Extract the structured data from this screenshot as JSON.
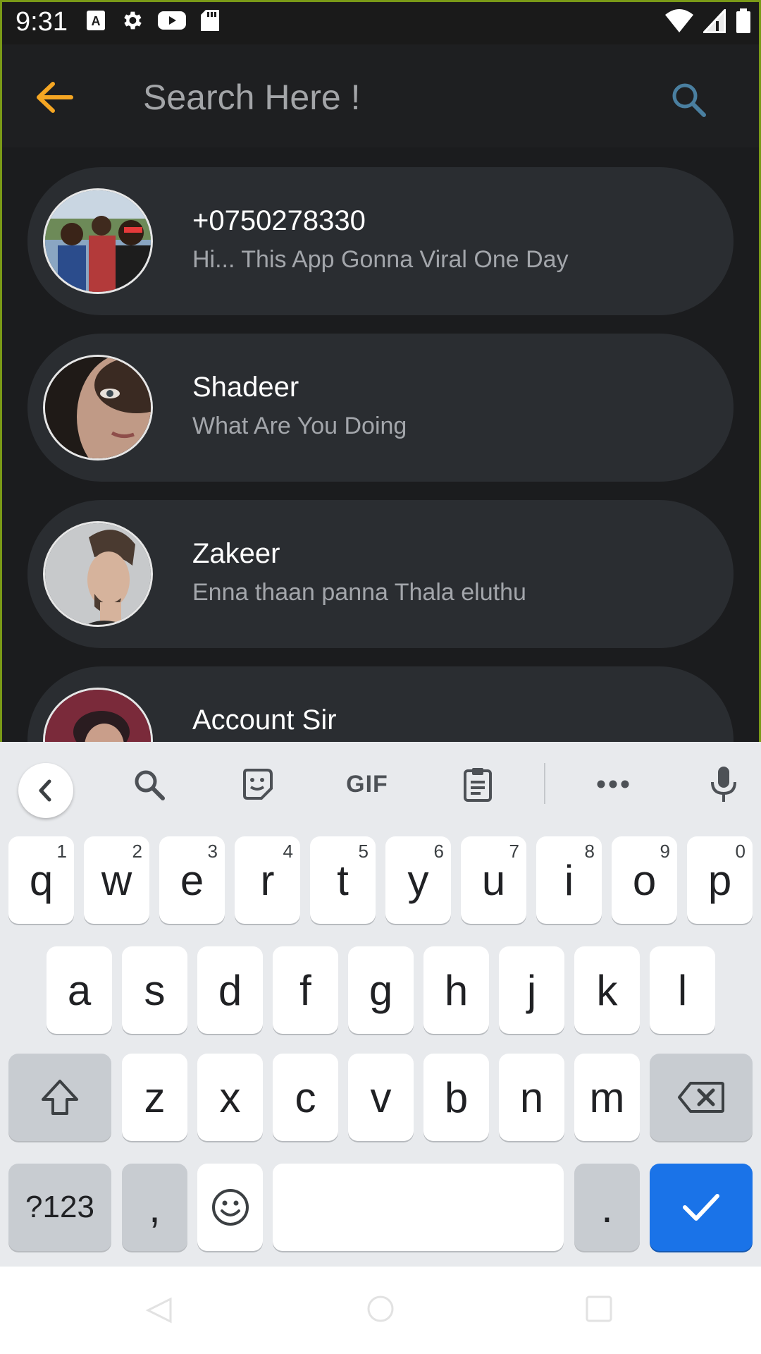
{
  "status_bar": {
    "time": "9:31"
  },
  "toolbar": {
    "search_placeholder": "Search Here !"
  },
  "chats": [
    {
      "name": "+0750278330",
      "message": "Hi... This App Gonna Viral One Day"
    },
    {
      "name": "Shadeer",
      "message": "What Are You Doing"
    },
    {
      "name": "Zakeer",
      "message": "Enna thaan panna Thala eluthu"
    },
    {
      "name": "Account Sir",
      "message": ""
    }
  ],
  "keyboard": {
    "gif_label": "GIF",
    "row1": [
      {
        "key": "q",
        "hint": "1"
      },
      {
        "key": "w",
        "hint": "2"
      },
      {
        "key": "e",
        "hint": "3"
      },
      {
        "key": "r",
        "hint": "4"
      },
      {
        "key": "t",
        "hint": "5"
      },
      {
        "key": "y",
        "hint": "6"
      },
      {
        "key": "u",
        "hint": "7"
      },
      {
        "key": "i",
        "hint": "8"
      },
      {
        "key": "o",
        "hint": "9"
      },
      {
        "key": "p",
        "hint": "0"
      }
    ],
    "row2": [
      "a",
      "s",
      "d",
      "f",
      "g",
      "h",
      "j",
      "k",
      "l"
    ],
    "row3": [
      "z",
      "x",
      "c",
      "v",
      "b",
      "n",
      "m"
    ],
    "symbols_label": "?123",
    "comma": ",",
    "period": "."
  },
  "colors": {
    "accent_back": "#f5a623",
    "search_icon": "#4a7fa0",
    "card_bg": "#2a2d31",
    "action_key": "#1a73e8"
  }
}
